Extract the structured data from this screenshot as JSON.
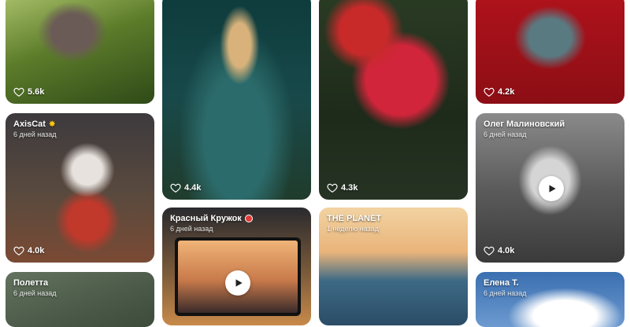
{
  "cards": [
    {
      "id": "c1",
      "likes": "5.6k"
    },
    {
      "id": "c2",
      "author": "AxisCat",
      "time": "6 дней назад",
      "likes": "4.0k",
      "badge": "star"
    },
    {
      "id": "c3",
      "author": "Полетта",
      "time": "6 дней назад"
    },
    {
      "id": "c4",
      "likes": "4.4k"
    },
    {
      "id": "c5",
      "author": "Красный Кружок",
      "time": "6 дней назад",
      "badge": "red-dot",
      "video": true
    },
    {
      "id": "c6",
      "likes": "4.3k"
    },
    {
      "id": "c7",
      "author": "THE PLANET",
      "time": "1 неделю назад"
    },
    {
      "id": "c8",
      "likes": "4.2k"
    },
    {
      "id": "c9",
      "author": "Олег Малиновский",
      "time": "6 дней назад",
      "likes": "4.0k",
      "video": true
    },
    {
      "id": "c10",
      "author": "Елена Т.",
      "time": "6 дней назад"
    }
  ],
  "colors": {
    "like_text": "#ffffff",
    "badge_star": "#f5c518",
    "badge_dot": "#e53935"
  }
}
